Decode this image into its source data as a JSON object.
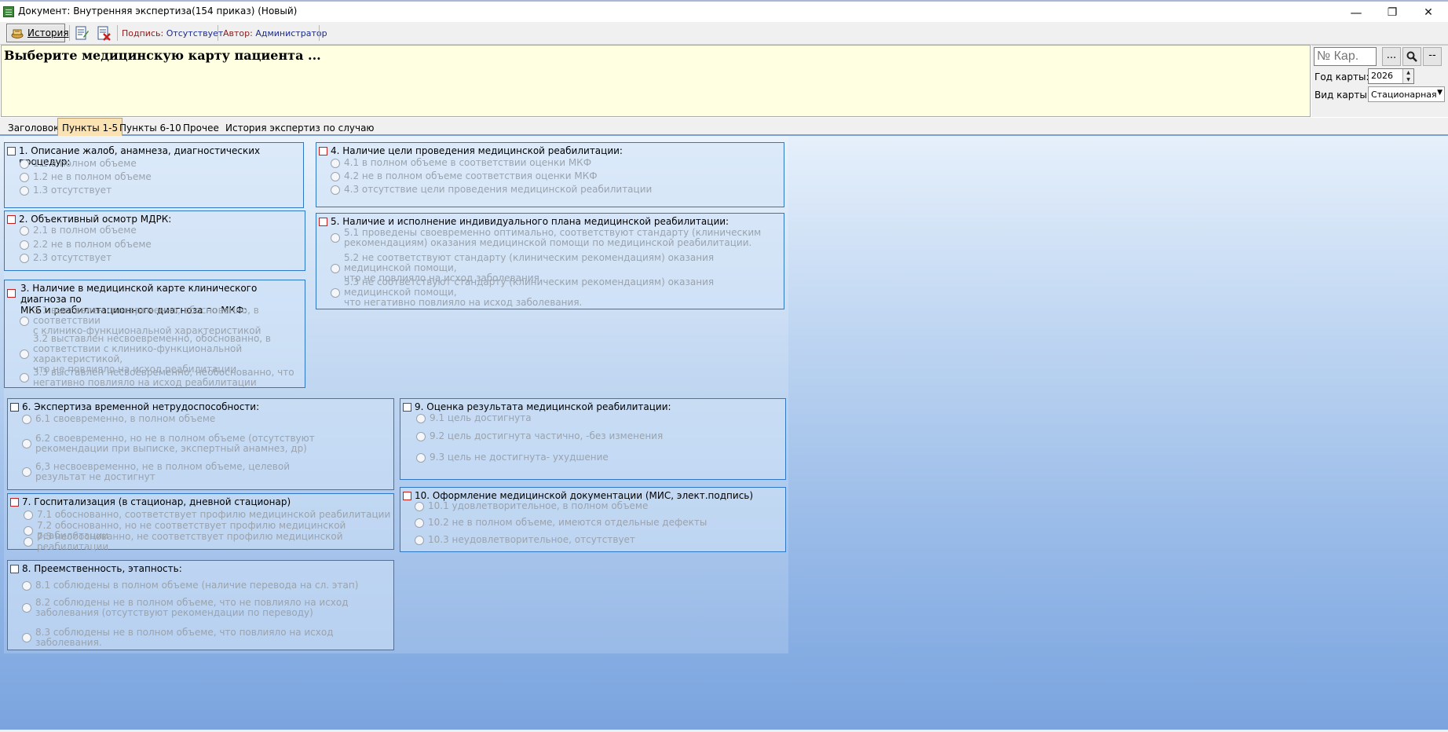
{
  "window": {
    "title": "Документ: Внутренняя экспертиза(154 приказ) (Новый)",
    "minimize": "—",
    "restore": "❐",
    "close": "✕"
  },
  "toolbar": {
    "history_label": "История",
    "signature_label": "Подпись:",
    "signature_value": "Отсутствует",
    "author_label": "Автор:",
    "author_value": "Администратор"
  },
  "header": {
    "message": "Выберите медицинскую карту пациента ..."
  },
  "card_panel": {
    "card_placeholder": "№ Кар.",
    "browse_button": "...",
    "search_icon": "search-icon",
    "clear_button": "--",
    "year_label": "Год карты:",
    "year_value": "2026",
    "type_label": "Вид карты:",
    "type_value": "Стационарная"
  },
  "tabs": [
    {
      "label": "Заголовок"
    },
    {
      "label": "Пункты 1-5"
    },
    {
      "label": "Пункты 6-10"
    },
    {
      "label": "Прочее"
    },
    {
      "label": "История экспертиз по случаю"
    }
  ],
  "active_tab": "Пункты 1-5",
  "colors": {
    "accent_border": "#2f78c8",
    "checkbox_border": "#c81e1e",
    "active_tab": "#fbe2b3",
    "header_bg": "#ffffe1"
  },
  "sections": {
    "s1": {
      "title": "1. Описание жалоб, анамнеза, диагностических процедур:",
      "options": [
        "1.1 в полном объеме",
        "1.2 не в полном объеме",
        "1.3 отсутствует"
      ]
    },
    "s2": {
      "title": "2. Объективный осмотр МДРК:",
      "options": [
        "2.1 в полном объеме",
        "2.2 не в полном объеме",
        "2.3 отсутствует"
      ]
    },
    "s3": {
      "title_line1": "3. Наличие в медицинской карте клинического диагноза по",
      "title_line2": "МКБ и реабилитационного диагноза по МКФ:",
      "options": [
        [
          "3.1 выставлен своевременно, обоснованно, в соответствии",
          "с клинико-функциональной характеристикой"
        ],
        [
          "3.2 выставлен несвоевременно, обоснованно, в",
          "соответствии с клинико-функциональной характеристикой,",
          "что не повлияло на исход реабилитации"
        ],
        [
          "3.3 выставлен несвоевременно, необоснованно, что",
          "негативно повлияло на исход реабилитации"
        ]
      ]
    },
    "s4": {
      "title": "4. Наличие цели проведения медицинской реабилитации:",
      "options": [
        "4.1 в полном объеме в соответствии оценки МКФ",
        "4.2 не в полном объеме соответствия оценки МКФ",
        "4.3 отсутствие цели проведения медицинской реабилитации"
      ]
    },
    "s5": {
      "title": "5. Наличие и исполнение индивидуального плана медицинской реабилитации:",
      "options": [
        [
          "5.1 проведены своевременно оптимально, соответствуют стандарту (клиническим",
          "рекомендациям) оказания медицинской помощи по медицинской реабилитации."
        ],
        [
          "5.2 не соответствуют стандарту (клиническим рекомендациям) оказания медицинской помощи,",
          "что не повлияло на исход заболевания."
        ],
        [
          "5.3 не соответствуют стандарту (клиническим рекомендациям) оказания медицинской помощи,",
          "что негативно повлияло на исход заболевания."
        ]
      ]
    },
    "s6": {
      "title": "6. Экспертиза временной нетрудоспособности:",
      "options": [
        [
          "6.1 своевременно, в полном объеме"
        ],
        [
          "6.2 своевременно, но не в полном объеме (отсутствуют",
          "рекомендации при выписке, экспертный анамнез, др)"
        ],
        [
          "6,3 несвоевременно, не в полном объеме, целевой",
          "результат не достигнут"
        ]
      ]
    },
    "s7": {
      "title": "7. Госпитализация (в стационар, дневной стационар)",
      "options": [
        "7.1 обоснованно, соответствует профилю медицинской реабилитации",
        "7.2 обоснованно, но не соответствует профилю медицинской реабилитации",
        "7.3 необоснованно, не соответствует профилю медицинской реабилитации"
      ]
    },
    "s8": {
      "title": "8. Преемственность, этапность:",
      "options": [
        [
          "8.1 соблюдены в полном объеме (наличие перевода на сл. этап)"
        ],
        [
          "8.2 соблюдены не в полном объеме, что не повлияло на исход",
          "заболевания (отсутствуют рекомендации по переводу)"
        ],
        [
          "8.3 соблюдены не в полном объеме, что повлияло на исход заболевания."
        ]
      ]
    },
    "s9": {
      "title": "9. Оценка результата медицинской реабилитации:",
      "options": [
        "9.1 цель достигнута",
        "9.2 цель достигнута частично, -без изменения",
        "9.3 цель не достигнута- ухудшение"
      ]
    },
    "s10": {
      "title": "10. Оформление медицинской документации (МИС, элект.подпись)",
      "options": [
        "10.1 удовлетворительное, в полном объеме",
        "10.2 не в полном объеме, имеются отдельные дефекты",
        "10.3 неудовлетворительное, отсутствует"
      ]
    }
  }
}
